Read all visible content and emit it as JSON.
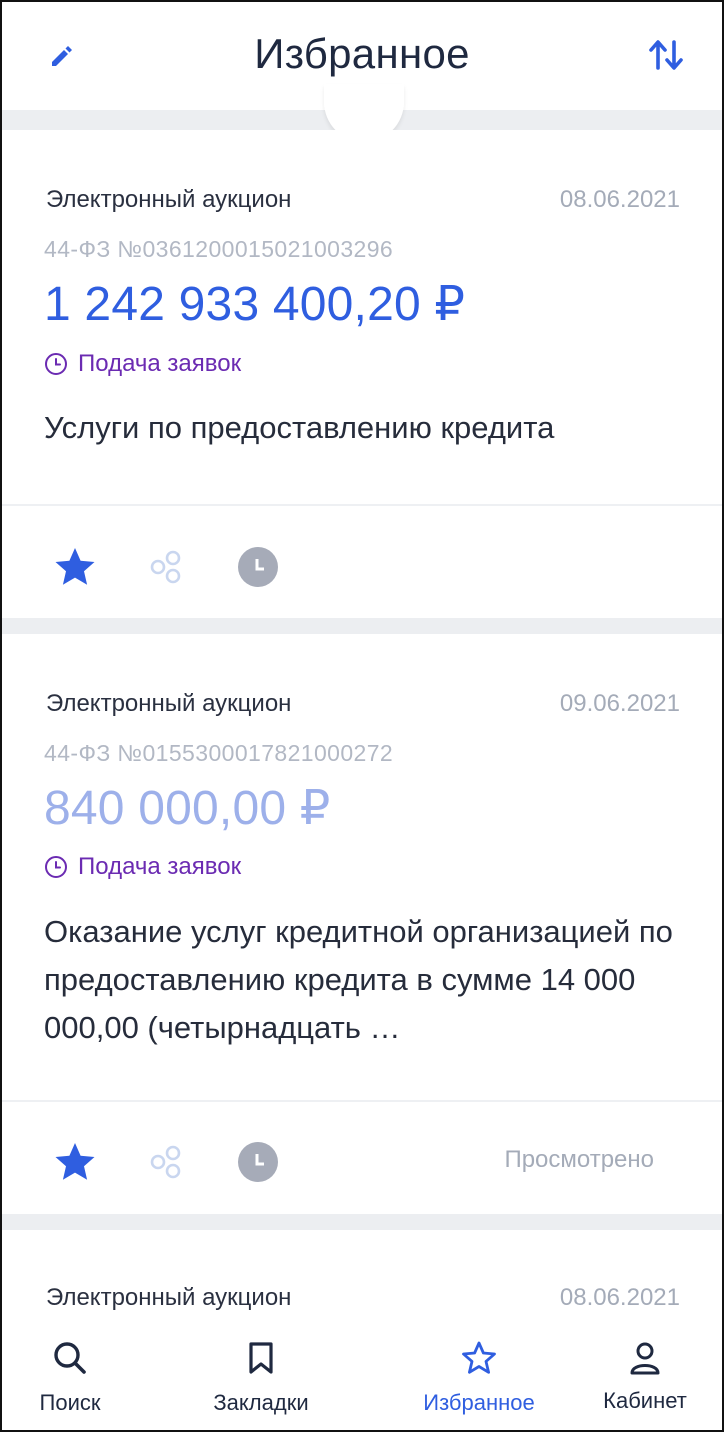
{
  "header": {
    "title": "Избранное",
    "edit_icon": "pencil-icon",
    "sort_icon": "sort-arrows-icon",
    "accent_color": "#2f5ee0"
  },
  "cards": [
    {
      "type": "Электронный аукцион",
      "date": "08.06.2021",
      "reg_number": "44-ФЗ №0361200015021003296",
      "price": "1 242 933 400,20 ₽",
      "status": "Подача заявок",
      "description": "Услуги по предоставлению кредита",
      "viewed_label": ""
    },
    {
      "type": "Электронный аукцион",
      "date": "09.06.2021",
      "reg_number": "44-ФЗ №0155300017821000272",
      "price": "840 000,00 ₽",
      "status": "Подача заявок",
      "description": "Оказание услуг кредитной организацией по предоставлению кредита в сумме 14 000 000,00 (четырнадцать  …",
      "viewed_label": "Просмотрено"
    },
    {
      "type": "Электронный аукцион",
      "date": "08.06.2021"
    }
  ],
  "nav": {
    "items": [
      {
        "label": "Поиск",
        "icon": "search-icon"
      },
      {
        "label": "Закладки",
        "icon": "bookmark-icon"
      },
      {
        "label": "Избранное",
        "icon": "star-icon",
        "active": true
      },
      {
        "label": "Кабинет",
        "icon": "user-icon"
      }
    ]
  },
  "colors": {
    "price_active": "#2f5ee0",
    "price_viewed": "#9db0ea",
    "status": "#6b2bb2",
    "star": "#2f5ee0",
    "muted": "#a4abb8"
  }
}
